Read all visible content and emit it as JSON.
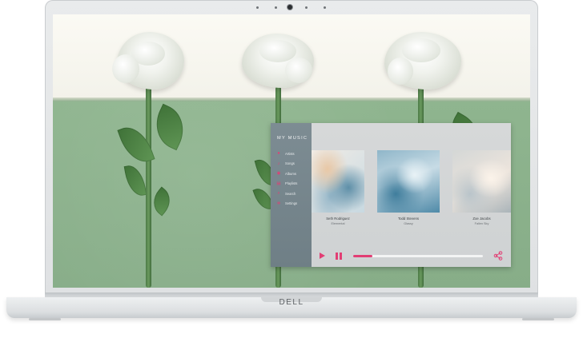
{
  "brand": {
    "logo": "DELL"
  },
  "app": {
    "title": "MY MUSIC",
    "accent_color": "#e23e74",
    "menu": [
      {
        "label": "Artists",
        "icon": "person-icon",
        "glyph": "●"
      },
      {
        "label": "Songs",
        "icon": "music-note-icon",
        "glyph": "♪"
      },
      {
        "label": "Albums",
        "icon": "album-icon",
        "glyph": "◉"
      },
      {
        "label": "Playlists",
        "icon": "playlist-icon",
        "glyph": "▤"
      },
      {
        "label": "Search",
        "icon": "search-icon",
        "glyph": "⌕"
      },
      {
        "label": "Settings",
        "icon": "gear-icon",
        "glyph": "✲"
      }
    ],
    "albums": [
      {
        "artist": "Seth Rodriguez",
        "track": "Elemental"
      },
      {
        "artist": "Todd Stevens",
        "track": "Glassy"
      },
      {
        "artist": "Zoe Jacobs",
        "track": "Fallen Sky"
      }
    ],
    "player": {
      "progress": 0.15
    }
  }
}
